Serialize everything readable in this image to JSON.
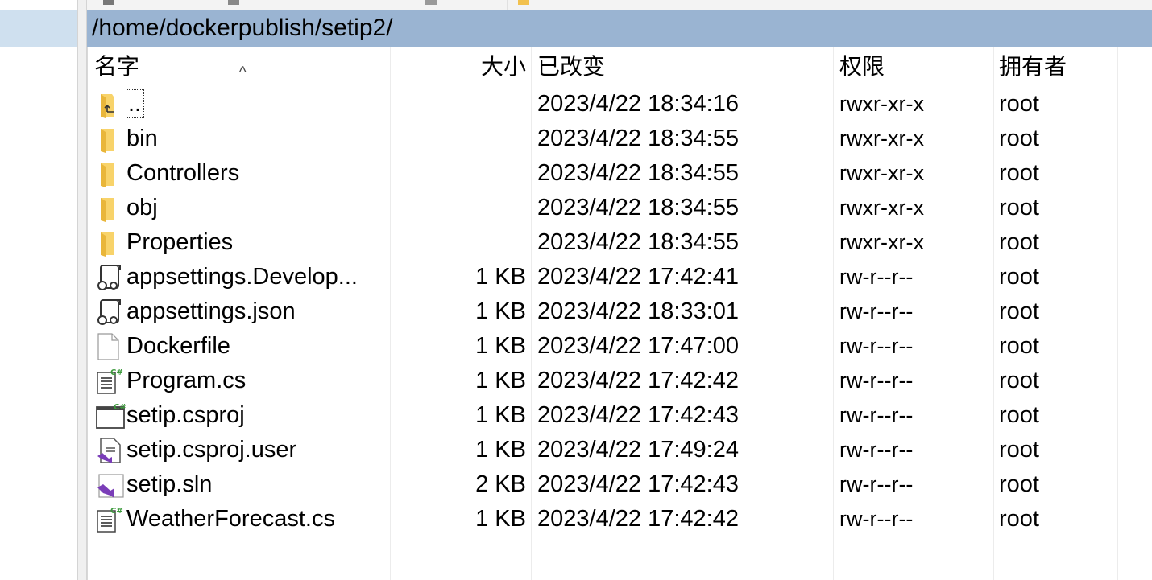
{
  "path_bar": {
    "path": "/home/dockerpublish/setip2/"
  },
  "columns": {
    "name": "名字",
    "size": "大小",
    "modified": "已改变",
    "permissions": "权限",
    "owner": "拥有者"
  },
  "colors": {
    "path_bar_bg": "#9ab4d2",
    "folder": "#f8d36a",
    "vs_purple": "#7a3db8",
    "csharp_green": "#3c9a3c"
  },
  "files": [
    {
      "name": "..",
      "size": "",
      "modified": "2023/4/22 18:34:16",
      "permissions": "rwxr-xr-x",
      "owner": "root",
      "icon": "parent-folder-icon"
    },
    {
      "name": "bin",
      "size": "",
      "modified": "2023/4/22 18:34:55",
      "permissions": "rwxr-xr-x",
      "owner": "root",
      "icon": "folder-icon"
    },
    {
      "name": "Controllers",
      "size": "",
      "modified": "2023/4/22 18:34:55",
      "permissions": "rwxr-xr-x",
      "owner": "root",
      "icon": "folder-icon"
    },
    {
      "name": "obj",
      "size": "",
      "modified": "2023/4/22 18:34:55",
      "permissions": "rwxr-xr-x",
      "owner": "root",
      "icon": "folder-icon"
    },
    {
      "name": "Properties",
      "size": "",
      "modified": "2023/4/22 18:34:55",
      "permissions": "rwxr-xr-x",
      "owner": "root",
      "icon": "folder-icon"
    },
    {
      "name": "appsettings.Develop...",
      "size": "1 KB",
      "modified": "2023/4/22 17:42:41",
      "permissions": "rw-r--r--",
      "owner": "root",
      "icon": "json-file-icon"
    },
    {
      "name": "appsettings.json",
      "size": "1 KB",
      "modified": "2023/4/22 18:33:01",
      "permissions": "rw-r--r--",
      "owner": "root",
      "icon": "json-file-icon"
    },
    {
      "name": "Dockerfile",
      "size": "1 KB",
      "modified": "2023/4/22 17:47:00",
      "permissions": "rw-r--r--",
      "owner": "root",
      "icon": "blank-file-icon"
    },
    {
      "name": "Program.cs",
      "size": "1 KB",
      "modified": "2023/4/22 17:42:42",
      "permissions": "rw-r--r--",
      "owner": "root",
      "icon": "csharp-file-icon"
    },
    {
      "name": "setip.csproj",
      "size": "1 KB",
      "modified": "2023/4/22 17:42:43",
      "permissions": "rw-r--r--",
      "owner": "root",
      "icon": "csproj-file-icon"
    },
    {
      "name": "setip.csproj.user",
      "size": "1 KB",
      "modified": "2023/4/22 17:49:24",
      "permissions": "rw-r--r--",
      "owner": "root",
      "icon": "vs-user-file-icon"
    },
    {
      "name": "setip.sln",
      "size": "2 KB",
      "modified": "2023/4/22 17:42:43",
      "permissions": "rw-r--r--",
      "owner": "root",
      "icon": "vs-solution-icon"
    },
    {
      "name": "WeatherForecast.cs",
      "size": "1 KB",
      "modified": "2023/4/22 17:42:42",
      "permissions": "rw-r--r--",
      "owner": "root",
      "icon": "csharp-file-icon"
    }
  ]
}
